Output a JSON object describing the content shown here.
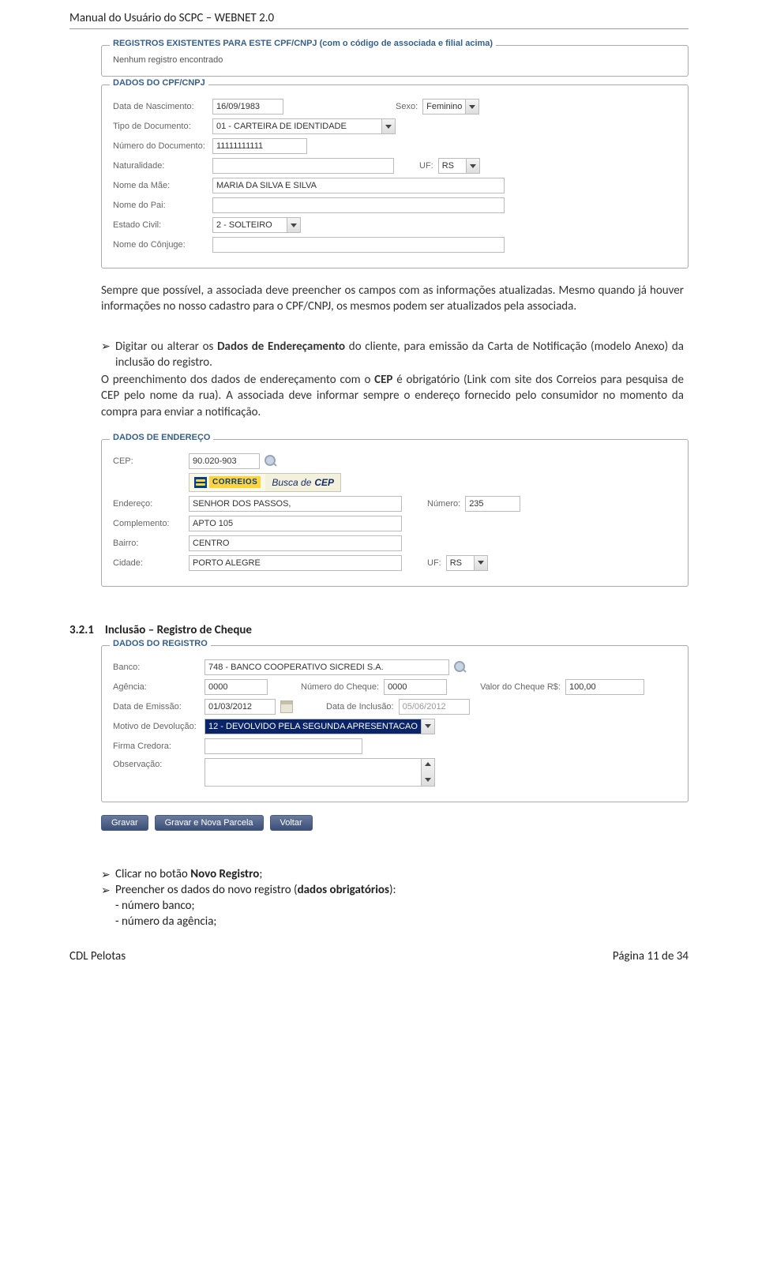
{
  "doc": {
    "header_title": "Manual do Usuário do SCPC – WEBNET 2.0",
    "footer_left": "CDL Pelotas",
    "footer_right": "Página 11 de 34"
  },
  "panel_registros": {
    "legend": "REGISTROS EXISTENTES PARA ESTE CPF/CNPJ (com o código de associada e filial acima)",
    "msg": "Nenhum registro encontrado"
  },
  "panel_cpf": {
    "legend": "DADOS DO CPF/CNPJ",
    "lbl_nasc": "Data de Nascimento:",
    "val_nasc": "16/09/1983",
    "lbl_sexo": "Sexo:",
    "val_sexo": "Feminino",
    "lbl_tipodoc": "Tipo de Documento:",
    "val_tipodoc": "01 - CARTEIRA DE IDENTIDADE",
    "lbl_numdoc": "Número do Documento:",
    "val_numdoc": "11111111111",
    "lbl_nat": "Naturalidade:",
    "lbl_uf": "UF:",
    "val_uf": "RS",
    "lbl_mae": "Nome da Mãe:",
    "val_mae": "MARIA DA SILVA E SILVA",
    "lbl_pai": "Nome do Pai:",
    "lbl_estciv": "Estado Civil:",
    "val_estciv": "2 - SOLTEIRO",
    "lbl_conj": "Nome do Cônjuge:"
  },
  "paragraphs": {
    "p1": "Sempre que possível, a associada deve preencher os campos com as informações atualizadas. Mesmo quando já houver informações no nosso cadastro para o CPF/CNPJ, os mesmos podem ser atualizados pela associada.",
    "p2a": "Digitar ou alterar os ",
    "p2b_bold": "Dados de Endereçamento",
    "p2c": " do cliente, para emissão da Carta de Notificação (modelo Anexo) da inclusão do registro.",
    "p3a": "O preenchimento dos dados de endereçamento com o ",
    "p3b_bold": "CEP",
    "p3c": " é obrigatório (Link com site dos Correios para pesquisa de CEP pelo nome da rua). A associada deve informar sempre o endereço fornecido pelo consumidor no momento da compra para enviar a notificação."
  },
  "panel_end": {
    "legend": "DADOS DE ENDEREÇO",
    "lbl_cep": "CEP:",
    "val_cep": "90.020-903",
    "correios_busca": "Busca de",
    "correios_cep": "CEP",
    "correios_word": "CORREIOS",
    "lbl_end": "Endereço:",
    "val_end": "SENHOR DOS PASSOS,",
    "lbl_num": "Número:",
    "val_num": "235",
    "lbl_compl": "Complemento:",
    "val_compl": "APTO 105",
    "lbl_bairro": "Bairro:",
    "val_bairro": "CENTRO",
    "lbl_cidade": "Cidade:",
    "val_cidade": "PORTO ALEGRE",
    "lbl_uf": "UF:",
    "val_uf": "RS"
  },
  "section_heading": {
    "num": "3.2.1",
    "title": "Inclusão – Registro de Cheque"
  },
  "panel_reg": {
    "legend": "DADOS DO REGISTRO",
    "lbl_banco": "Banco:",
    "val_banco": "748 - BANCO COOPERATIVO SICREDI S.A.",
    "lbl_agencia": "Agência:",
    "val_agencia": "0000",
    "lbl_numcheque": "Número do Cheque:",
    "val_numcheque": "0000",
    "lbl_valor": "Valor do Cheque R$:",
    "val_valor": "100,00",
    "lbl_emissao": "Data de Emissão:",
    "val_emissao": "01/03/2012",
    "lbl_inclusao": "Data de Inclusão:",
    "val_inclusao": "05/06/2012",
    "lbl_motivo": "Motivo de Devolução:",
    "val_motivo": "12 - DEVOLVIDO PELA SEGUNDA APRESENTACAO",
    "lbl_firma": "Firma Credora:",
    "lbl_obs": "Observação:"
  },
  "buttons": {
    "gravar": "Gravar",
    "gravar_nova": "Gravar e Nova Parcela",
    "voltar": "Voltar"
  },
  "instructions": {
    "i1a": "Clicar no botão ",
    "i1b_bold": "Novo Registro",
    "i1c": ";",
    "i2a": "Preencher os dados do novo registro (",
    "i2b_bold": "dados obrigatórios",
    "i2c": "):",
    "s1": "- número banco;",
    "s2": "- número da agência;"
  }
}
